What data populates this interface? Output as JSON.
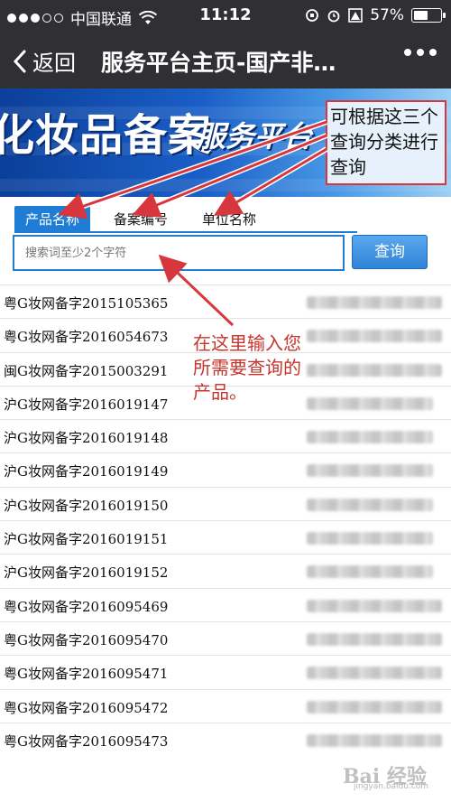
{
  "status_bar": {
    "carrier": "中国联通",
    "time": "11:12",
    "battery": "57%",
    "battery_level": 0.57
  },
  "nav": {
    "back_label": "返回",
    "title": "服务平台主页-国产非…"
  },
  "banner": {
    "title": "化妆品备案",
    "subtitle": "服务平台"
  },
  "tabs": [
    {
      "label": "产品名称",
      "active": true
    },
    {
      "label": "备案编号",
      "active": false
    },
    {
      "label": "单位名称",
      "active": false
    }
  ],
  "search": {
    "placeholder": "搜索词至少2个字符",
    "button_label": "查询"
  },
  "records": [
    "粤G妆网备字2015105365",
    "粤G妆网备字2016054673",
    "闽G妆网备字2015003291",
    "沪G妆网备字2016019147",
    "沪G妆网备字2016019148",
    "沪G妆网备字2016019149",
    "沪G妆网备字2016019150",
    "沪G妆网备字2016019151",
    "沪G妆网备字2016019152",
    "粤G妆网备字2016095469",
    "粤G妆网备字2016095470",
    "粤G妆网备字2016095471",
    "粤G妆网备字2016095472",
    "粤G妆网备字2016095473"
  ],
  "annotations": {
    "tabs_note": "可根据这三个查询分类进行查询",
    "search_note": "在这里输入您所需要查询的产品。"
  },
  "watermark": {
    "text": "Bai 经验",
    "sub": "jingyan.baidu.com"
  },
  "colors": {
    "accent": "#1f7dd6",
    "annotation": "#d8363d",
    "bar": "#2f2f34"
  }
}
